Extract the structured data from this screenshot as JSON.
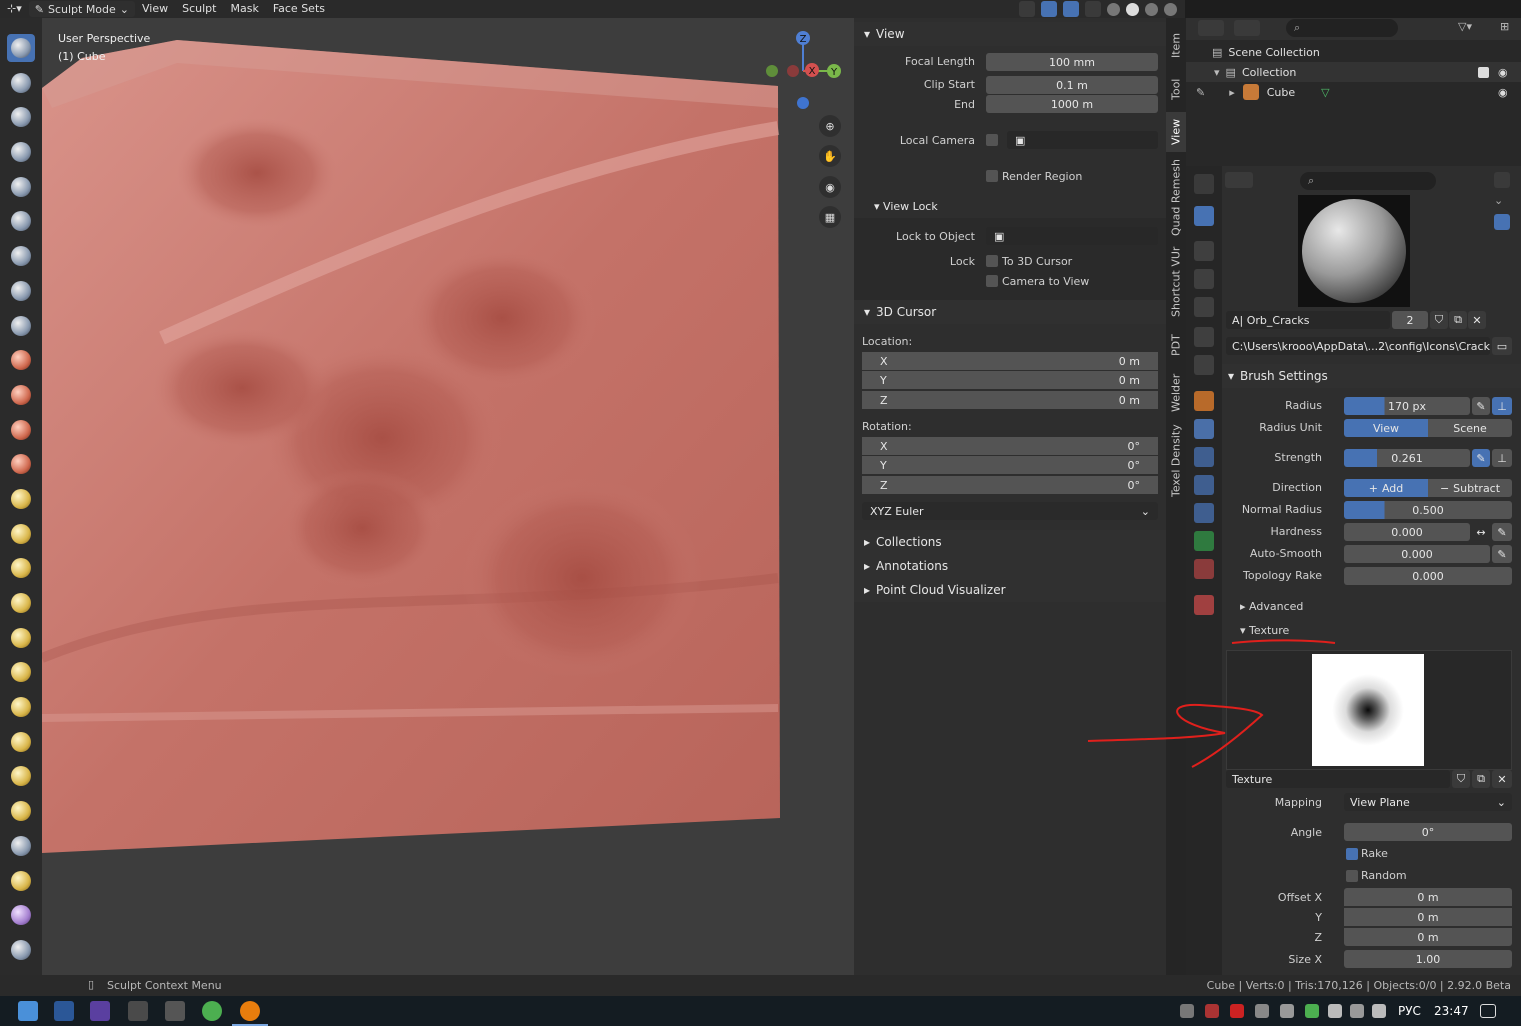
{
  "header": {
    "mode": "Sculpt Mode",
    "menus": [
      "View",
      "Sculpt",
      "Mask",
      "Face Sets"
    ]
  },
  "viewport": {
    "perspective": "User Perspective",
    "object": "(1) Cube",
    "gizmo": {
      "x": "X",
      "y": "Y",
      "z": "Z"
    }
  },
  "npanel": {
    "view": {
      "title": "View",
      "focal_label": "Focal Length",
      "focal_value": "100 mm",
      "clip_start_label": "Clip Start",
      "clip_start_value": "0.1 m",
      "end_label": "End",
      "end_value": "1000 m",
      "local_camera_label": "Local Camera",
      "render_region_label": "Render Region"
    },
    "view_lock": {
      "title": "View Lock",
      "lock_to_object_label": "Lock to Object",
      "lock_label": "Lock",
      "to_cursor_label": "To 3D Cursor",
      "camera_to_view_label": "Camera to View"
    },
    "cursor": {
      "title": "3D Cursor",
      "location_label": "Location:",
      "loc_x_label": "X",
      "loc_x": "0 m",
      "loc_y_label": "Y",
      "loc_y": "0 m",
      "loc_z_label": "Z",
      "loc_z": "0 m",
      "rotation_label": "Rotation:",
      "rot_x_label": "X",
      "rot_x": "0°",
      "rot_y_label": "Y",
      "rot_y": "0°",
      "rot_z_label": "Z",
      "rot_z": "0°",
      "rotation_mode": "XYZ Euler"
    },
    "collapsed": [
      "Collections",
      "Annotations",
      "Point Cloud Visualizer"
    ]
  },
  "vtabs": [
    "Item",
    "Tool",
    "View",
    "Quad Remesh",
    "Shortcut VUr",
    "PDT",
    "Welder",
    "Texel Density"
  ],
  "outliner": {
    "scene_collection": "Scene Collection",
    "collection": "Collection",
    "cube": "Cube"
  },
  "properties": {
    "brush_name": "A| Orb_Cracks",
    "brush_users": "2",
    "brush_path": "C:\\Users\\krooo\\AppData\\...2\\config\\Icons\\Cracks.png",
    "brush_settings_title": "Brush Settings",
    "radius_label": "Radius",
    "radius_value": "170 px",
    "radius_unit_label": "Radius Unit",
    "radius_unit_view": "View",
    "radius_unit_scene": "Scene",
    "strength_label": "Strength",
    "strength_value": "0.261",
    "direction_label": "Direction",
    "direction_add": "Add",
    "direction_subtract": "Subtract",
    "normal_radius_label": "Normal Radius",
    "normal_radius_value": "0.500",
    "hardness_label": "Hardness",
    "hardness_value": "0.000",
    "auto_smooth_label": "Auto-Smooth",
    "auto_smooth_value": "0.000",
    "topology_rake_label": "Topology Rake",
    "topology_rake_value": "0.000",
    "advanced_title": "Advanced",
    "texture_title": "Texture",
    "texture_name": "Texture",
    "mapping_label": "Mapping",
    "mapping_value": "View Plane",
    "angle_label": "Angle",
    "angle_value": "0°",
    "rake_label": "Rake",
    "random_label": "Random",
    "offset_x_label": "Offset X",
    "offset_x": "0 m",
    "offset_y_label": "Y",
    "offset_y": "0 m",
    "offset_z_label": "Z",
    "offset_z": "0 m",
    "size_x_label": "Size X",
    "size_x": "1.00"
  },
  "statusbar": {
    "context_menu": "Sculpt Context Menu",
    "stats": "Cube | Verts:0 | Tris:170,126 | Objects:0/0 | 2.92.0 Beta"
  },
  "taskbar": {
    "lang": "РУС",
    "time": "23:47"
  },
  "colors": {
    "accent": "#4772b3",
    "mesh": "#c97a70",
    "annotation": "#e0201c"
  }
}
